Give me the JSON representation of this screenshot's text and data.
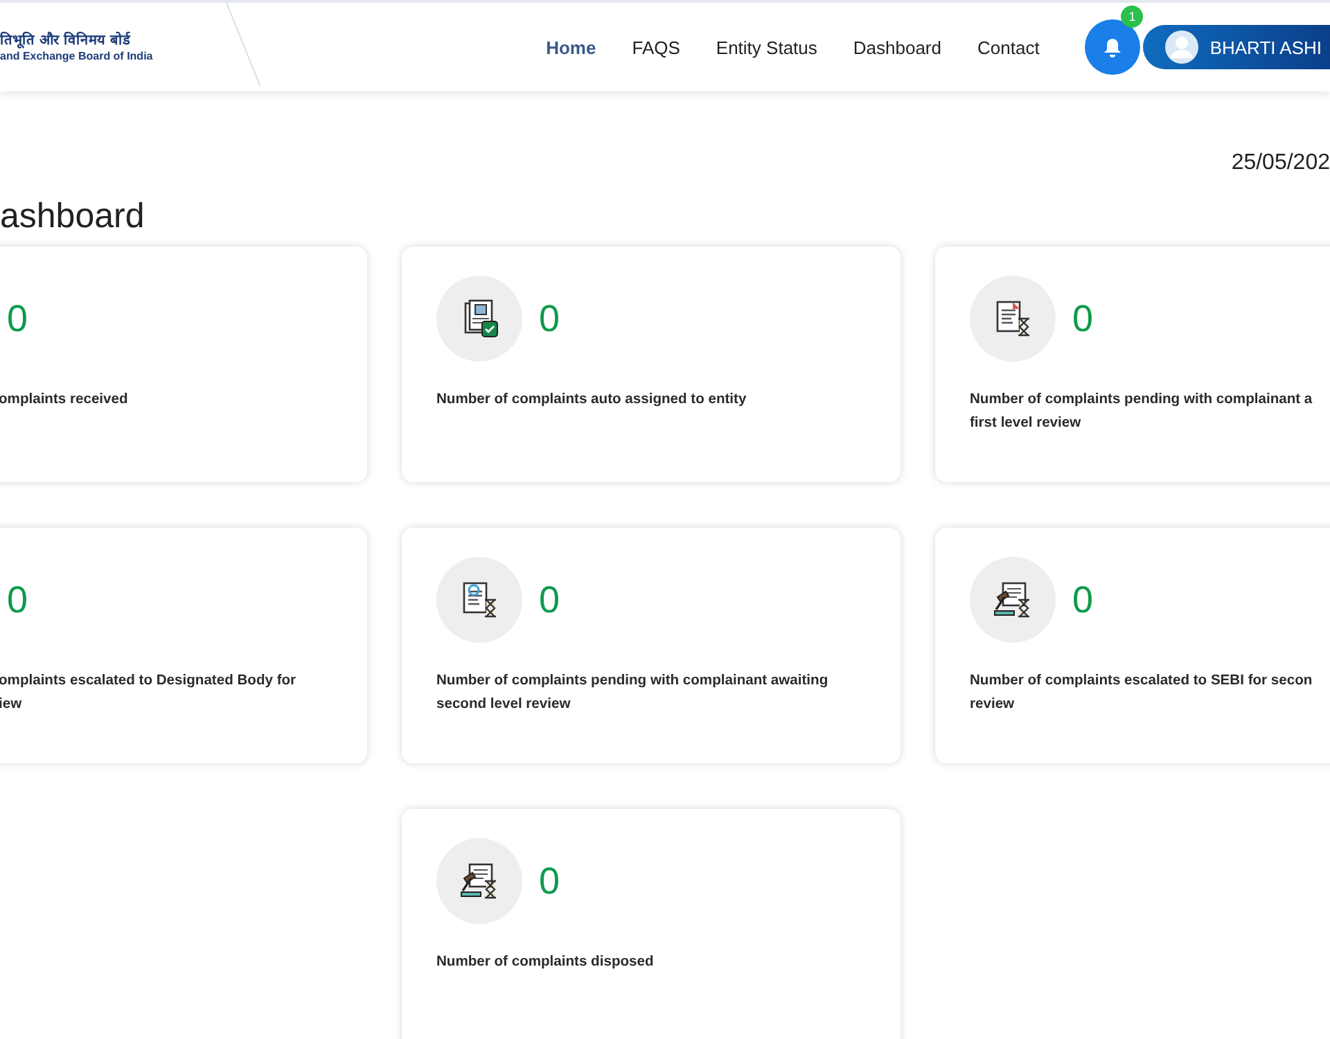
{
  "header": {
    "logo_lines": [
      "तिभूति और विनिमय बोर्ड",
      "and Exchange Board of India"
    ],
    "nav": [
      {
        "label": "Home",
        "selected": true
      },
      {
        "label": "FAQS",
        "selected": false
      },
      {
        "label": "Entity Status",
        "selected": false
      },
      {
        "label": "Dashboard",
        "selected": false
      },
      {
        "label": "Contact",
        "selected": false
      }
    ],
    "notifications": {
      "badge": "1"
    },
    "user": {
      "name": "BHARTI ASHI"
    }
  },
  "date": "25/05/202",
  "title": "ashboard",
  "cards": [
    {
      "kind": "cut",
      "value": "0",
      "label": "omplaints received"
    },
    {
      "kind": "assigned",
      "value": "0",
      "label": "Number of complaints auto assigned to entity"
    },
    {
      "kind": "pending",
      "value": "0",
      "label": "Number of complaints pending with complainant a\nfirst level review"
    },
    {
      "kind": "cut",
      "value": "0",
      "label": "omplaints escalated to Designated Body for\niew"
    },
    {
      "kind": "review",
      "value": "0",
      "label": "Number of complaints pending with complainant awaiting\nsecond level review"
    },
    {
      "kind": "escalated",
      "value": "0",
      "label": "Number of complaints escalated to SEBI for secon\nreview"
    },
    {
      "kind": "escalated",
      "value": "0",
      "label": "Number of complaints disposed"
    }
  ]
}
